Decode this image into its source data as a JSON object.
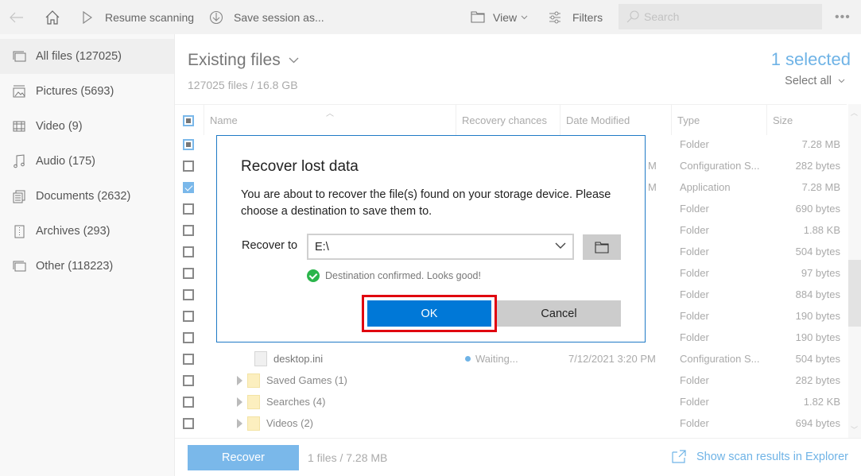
{
  "toolbar": {
    "back_label": "Back",
    "home_label": "Home",
    "resume_label": "Resume scanning",
    "save_label": "Save session as...",
    "view_label": "View",
    "filters_label": "Filters",
    "search_placeholder": "Search",
    "more_label": "•••"
  },
  "sidebar": {
    "items": [
      {
        "label": "All files (127025)",
        "icon": "all-files-icon",
        "active": true
      },
      {
        "label": "Pictures (5693)",
        "icon": "pictures-icon"
      },
      {
        "label": "Video (9)",
        "icon": "video-icon"
      },
      {
        "label": "Audio (175)",
        "icon": "audio-icon"
      },
      {
        "label": "Documents (2632)",
        "icon": "documents-icon"
      },
      {
        "label": "Archives (293)",
        "icon": "archives-icon"
      },
      {
        "label": "Other (118223)",
        "icon": "other-icon"
      }
    ]
  },
  "main": {
    "title": "Existing files",
    "subtitle": "127025 files / 16.8 GB",
    "selected_count": "1 selected",
    "select_all": "Select all"
  },
  "table": {
    "columns": [
      "Name",
      "Recovery chances",
      "Date Modified",
      "Type",
      "Size"
    ],
    "rows": [
      {
        "check": "partial",
        "name": "",
        "recovery": "",
        "date": "",
        "type": "Folder",
        "size": "7.28 MB"
      },
      {
        "check": "none",
        "name": "",
        "recovery": "",
        "date": "M",
        "type": "Configuration S...",
        "size": "282 bytes"
      },
      {
        "check": "checked",
        "name": "",
        "recovery": "",
        "date": "M",
        "type": "Application",
        "size": "7.28 MB"
      },
      {
        "check": "none",
        "name": "",
        "recovery": "",
        "date": "",
        "type": "Folder",
        "size": "690 bytes"
      },
      {
        "check": "none",
        "name": "",
        "recovery": "",
        "date": "",
        "type": "Folder",
        "size": "1.88 KB"
      },
      {
        "check": "none",
        "name": "",
        "recovery": "",
        "date": "",
        "type": "Folder",
        "size": "504 bytes"
      },
      {
        "check": "none",
        "name": "",
        "recovery": "",
        "date": "",
        "type": "Folder",
        "size": "97 bytes"
      },
      {
        "check": "none",
        "name": "",
        "recovery": "",
        "date": "",
        "type": "Folder",
        "size": "884 bytes"
      },
      {
        "check": "none",
        "name": "",
        "recovery": "",
        "date": "",
        "type": "Folder",
        "size": "190 bytes"
      },
      {
        "check": "none",
        "name": "",
        "recovery": "",
        "date": "",
        "type": "Folder",
        "size": "190 bytes"
      },
      {
        "check": "none",
        "name": "desktop.ini",
        "kind": "file",
        "recovery": "Waiting...",
        "date": "7/12/2021 3:20 PM",
        "type": "Configuration S...",
        "size": "504 bytes"
      },
      {
        "check": "none",
        "name": "Saved Games (1)",
        "kind": "folder",
        "recovery": "",
        "date": "",
        "type": "Folder",
        "size": "282 bytes"
      },
      {
        "check": "none",
        "name": "Searches (4)",
        "kind": "folder",
        "recovery": "",
        "date": "",
        "type": "Folder",
        "size": "1.82 KB"
      },
      {
        "check": "none",
        "name": "Videos (2)",
        "kind": "folder",
        "recovery": "",
        "date": "",
        "type": "Folder",
        "size": "694 bytes"
      }
    ]
  },
  "footer": {
    "recover_label": "Recover",
    "info": "1 files / 7.28 MB",
    "explorer_link": "Show scan results in Explorer"
  },
  "dialog": {
    "title": "Recover lost data",
    "text": "You are about to recover the file(s) found on your storage device. Please choose a destination to save them to.",
    "recover_to_label": "Recover to",
    "destination_value": "E:\\",
    "confirm_text": "Destination confirmed. Looks good!",
    "ok_label": "OK",
    "cancel_label": "Cancel"
  },
  "colors": {
    "accent": "#0078d7",
    "accent_light": "#7ab8ea",
    "highlight": "#e0000f",
    "success": "#2bb54b"
  }
}
